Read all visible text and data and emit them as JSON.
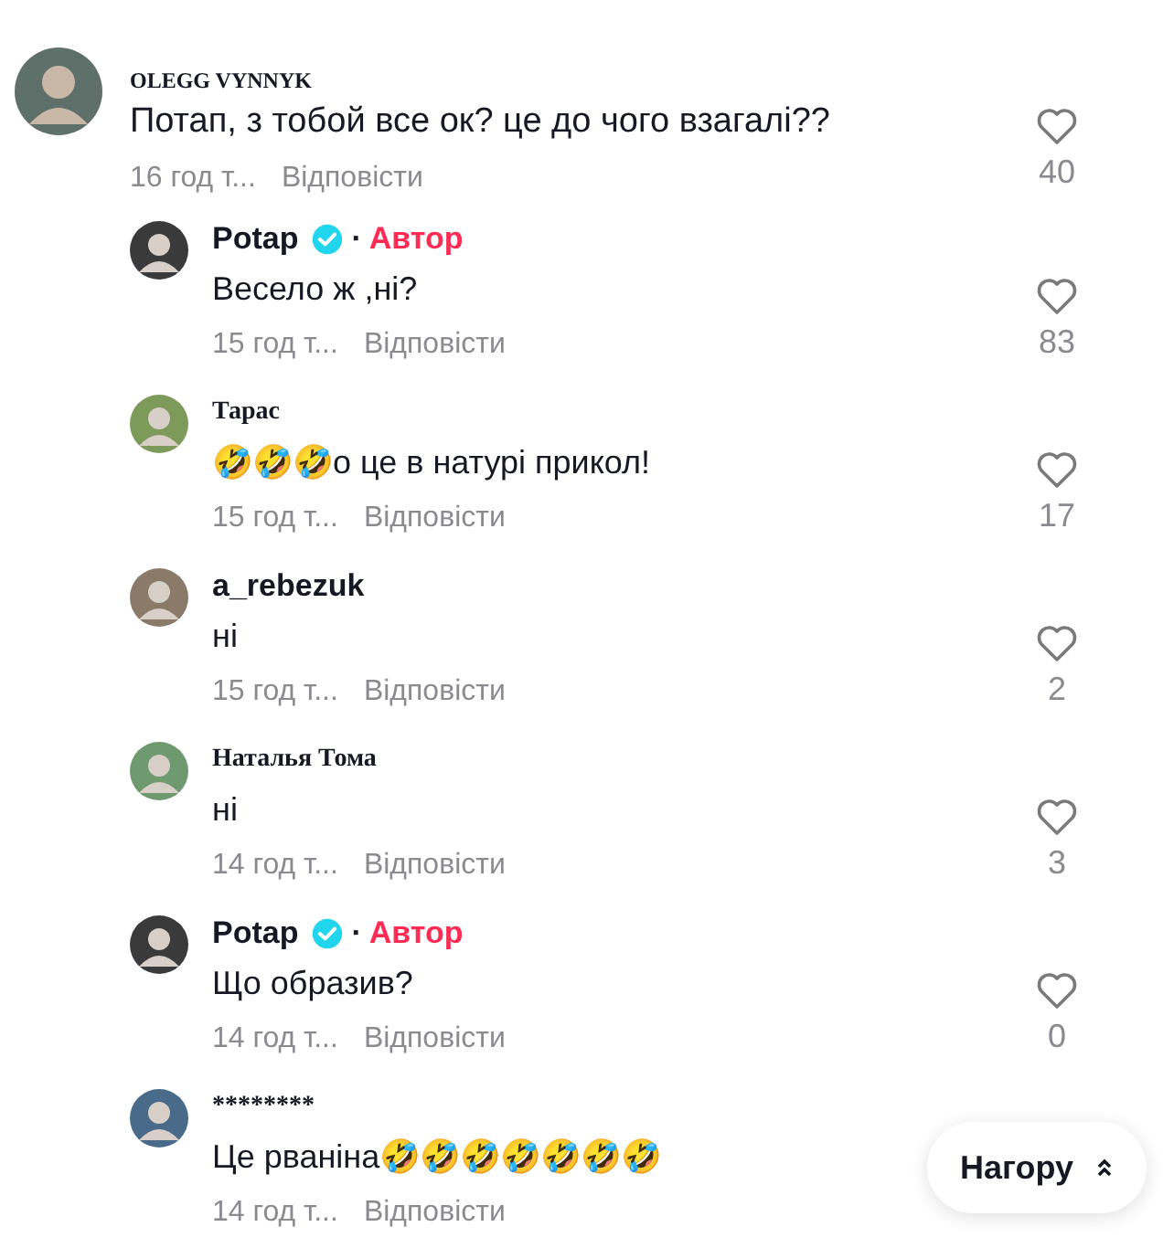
{
  "comments": [
    {
      "name": "OLEGG VYNNYK",
      "kind": "serif",
      "verified": false,
      "text": "Потап, з тобой все ок? це до чого взагалі??",
      "time": "16 год т...",
      "reply": "Відповісти",
      "likes": "40",
      "show_heart": true,
      "replies": [
        {
          "name": "Potap",
          "kind": "sans",
          "verified": true,
          "separator": "·",
          "badge": "Автор",
          "text": "Весело ж ,ні?",
          "time": "15 год т...",
          "reply": "Відповісти",
          "likes": "83",
          "show_heart": true
        },
        {
          "name": "Тарас",
          "kind": "serif",
          "verified": false,
          "text": "🤣🤣🤣о це в натурі прикол!",
          "time": "15 год т...",
          "reply": "Відповісти",
          "likes": "17",
          "show_heart": true
        },
        {
          "name": "a_rebezuk",
          "kind": "sans",
          "verified": false,
          "text": "ні",
          "time": "15 год т...",
          "reply": "Відповісти",
          "likes": "2",
          "show_heart": true
        },
        {
          "name": "Наталья Тома",
          "kind": "serif",
          "verified": false,
          "text": "ні",
          "time": "14 год т...",
          "reply": "Відповісти",
          "likes": "3",
          "show_heart": true
        },
        {
          "name": "Potap",
          "kind": "sans",
          "verified": true,
          "separator": "·",
          "badge": "Автор",
          "text": "Що образив?",
          "time": "14 год т...",
          "reply": "Відповісти",
          "likes": "0",
          "show_heart": true
        },
        {
          "name": "********",
          "kind": "serif",
          "verified": false,
          "text": "Це рваніна🤣🤣🤣🤣🤣🤣🤣",
          "time": "14 год т...",
          "reply": "Відповісти",
          "show_heart": false
        }
      ]
    }
  ],
  "top_button": {
    "label": "Нагору"
  }
}
